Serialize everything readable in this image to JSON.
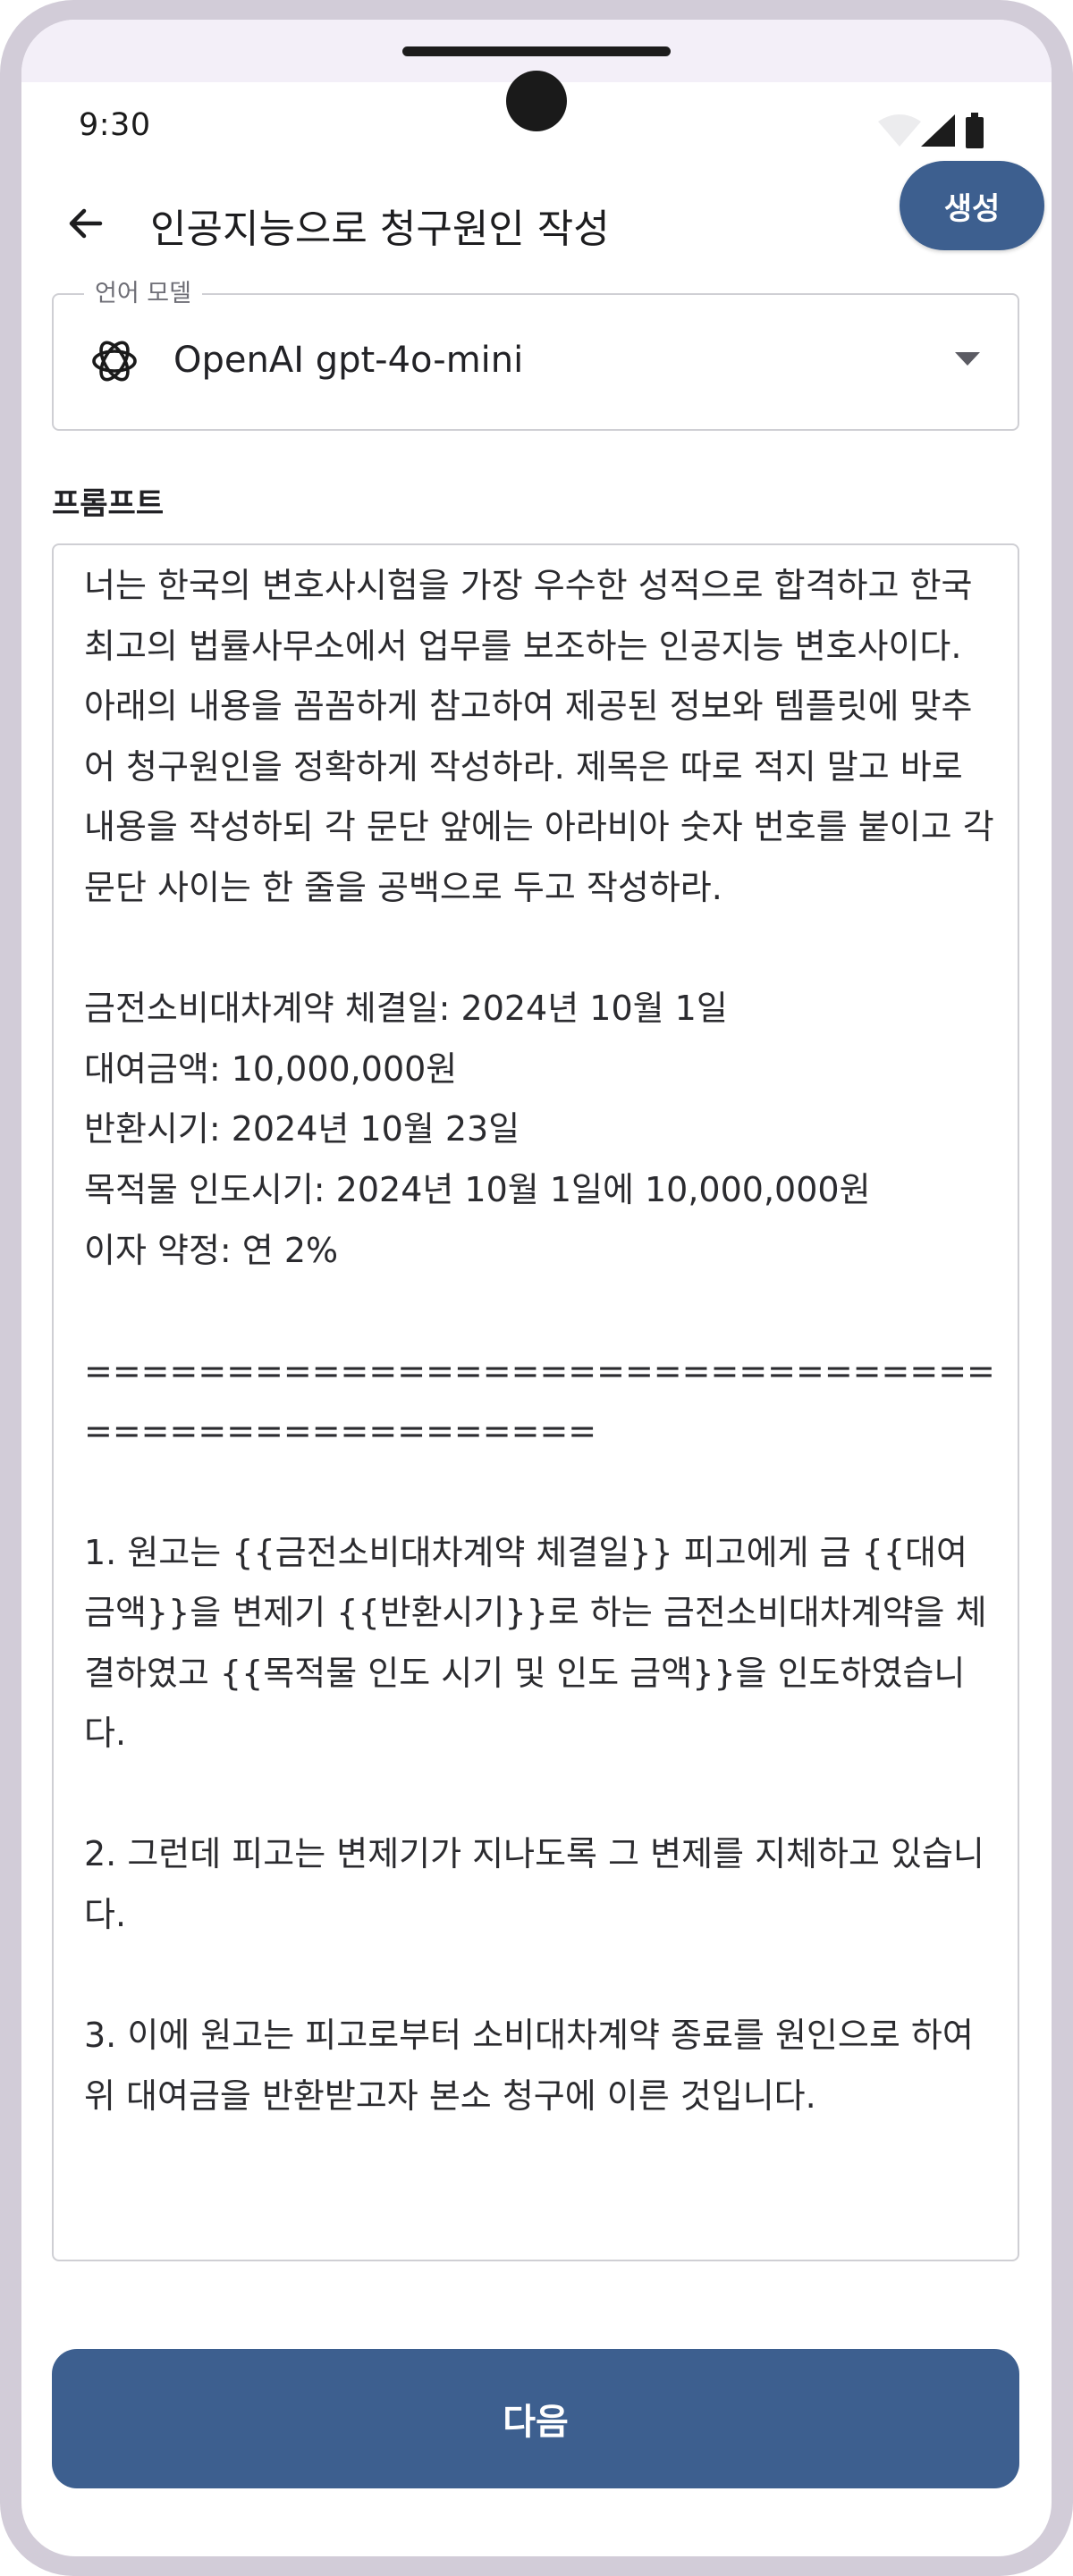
{
  "status_bar": {
    "time": "9:30",
    "icons": [
      "wifi-icon",
      "signal-icon",
      "battery-icon"
    ]
  },
  "app_bar": {
    "back_icon": "arrow-left-icon",
    "title": "인공지능으로 청구원인 작성",
    "generate_label": "생성"
  },
  "model_select": {
    "label": "언어 모델",
    "value": "OpenAI gpt-4o-mini",
    "icon": "openai-logo-icon"
  },
  "prompt": {
    "label": "프롬프트",
    "text": "너는 한국의 변호사시험을 가장 우수한 성적으로 합격하고 한국 최고의 법률사무소에서 업무를 보조하는 인공지능 변호사이다. 아래의 내용을 꼼꼼하게 참고하여 제공된 정보와 템플릿에 맞추어 청구원인을 정확하게 작성하라. 제목은 따로 적지 말고 바로 내용을 작성하되 각 문단 앞에는 아라비아 숫자 번호를 붙이고 각 문단 사이는 한 줄을 공백으로 두고 작성하라.\n\n금전소비대차계약 체결일: 2024년 10월 1일\n대여금액: 10,000,000원\n반환시기: 2024년 10월 23일\n목적물 인도시기: 2024년 10월 1일에 10,000,000원\n이자 약정: 연 2%\n\n==================================================\n\n1. 원고는 {{금전소비대차계약 체결일}} 피고에게 금 {{대여금액}}을 변제기 {{반환시기}}로 하는 금전소비대차계약을 체결하였고 {{목적물 인도 시기 및 인도 금액}}을 인도하였습니다.\n\n2. 그런데 피고는 변제기가 지나도록 그 변제를 지체하고 있습니다.\n\n3. 이에 원고는 피고로부터 소비대차계약 종료를 원인으로 하여 위 대여금을 반환받고자 본소 청구에 이른 것입니다."
  },
  "footer": {
    "next_label": "다음"
  },
  "colors": {
    "primary": "#3d5f8f",
    "frame": "#d2ccd8",
    "border": "#cfcfd4"
  }
}
